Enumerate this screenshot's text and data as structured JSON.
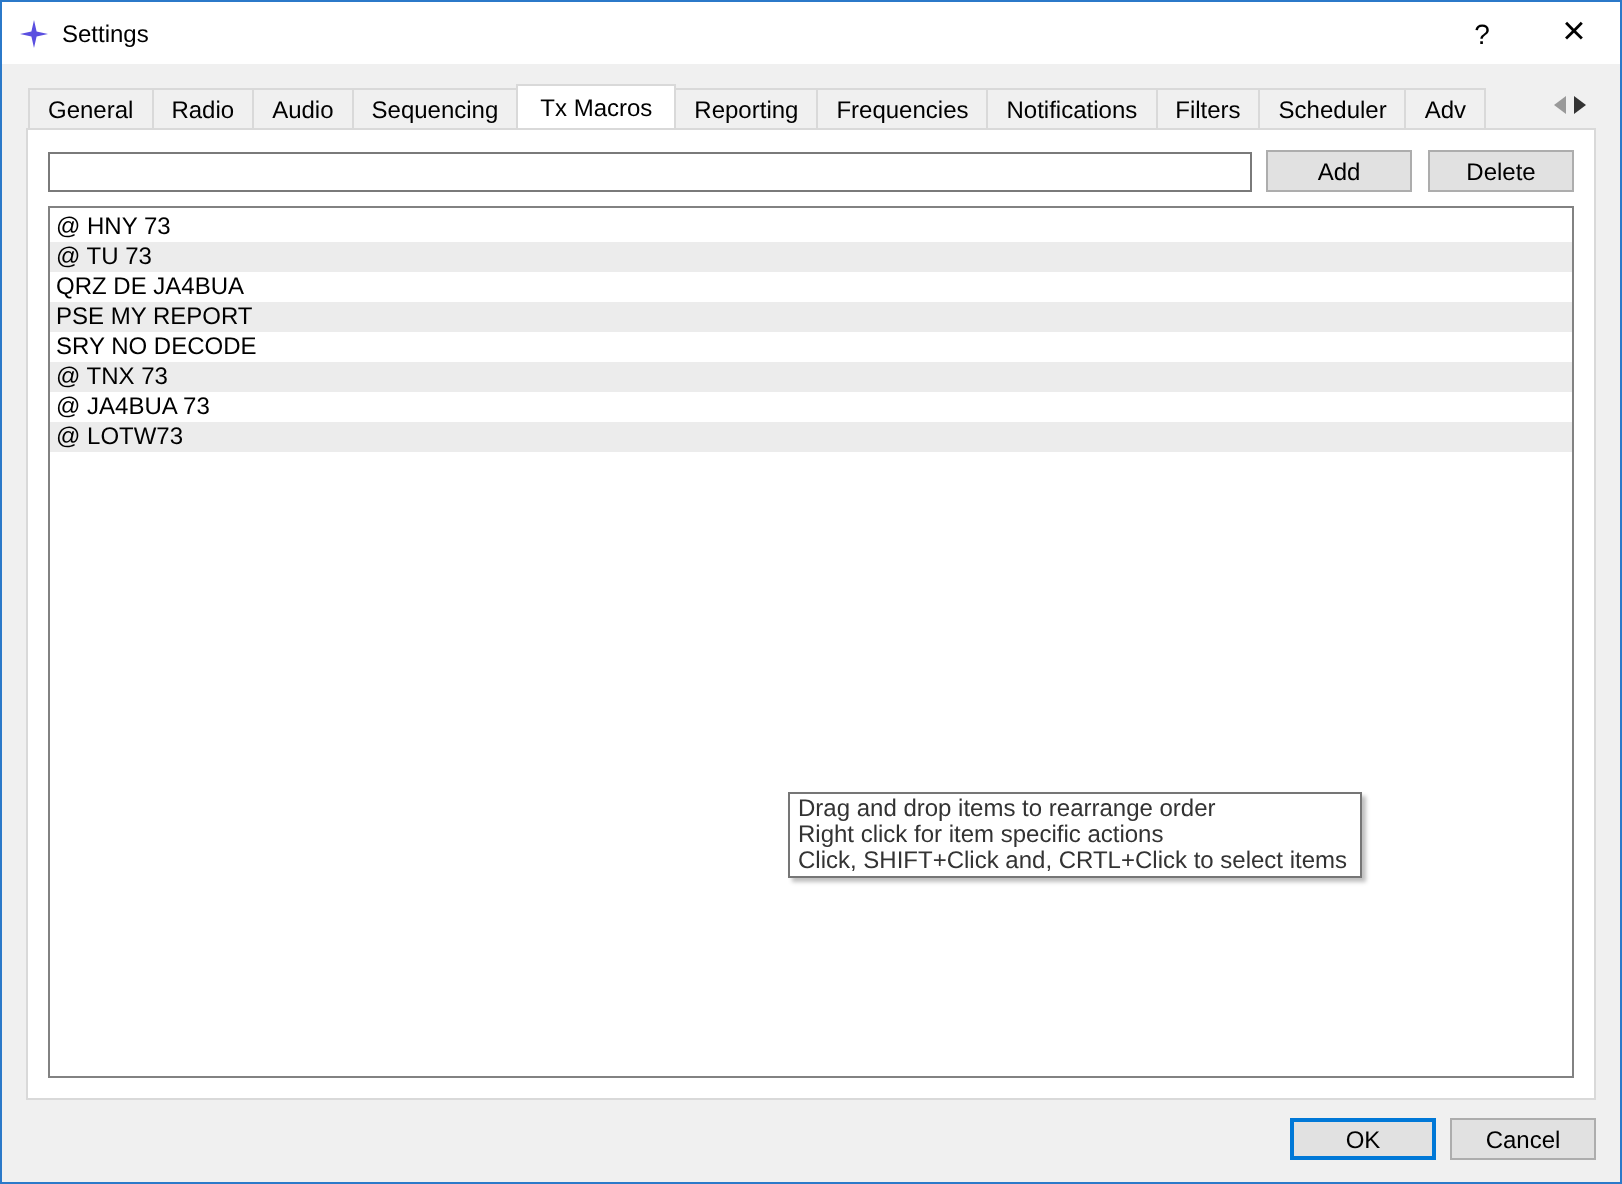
{
  "window": {
    "title": "Settings",
    "help": "?",
    "close": "×"
  },
  "tabs": [
    {
      "label": "General",
      "selected": false
    },
    {
      "label": "Radio",
      "selected": false
    },
    {
      "label": "Audio",
      "selected": false
    },
    {
      "label": "Sequencing",
      "selected": false
    },
    {
      "label": "Tx Macros",
      "selected": true
    },
    {
      "label": "Reporting",
      "selected": false
    },
    {
      "label": "Frequencies",
      "selected": false
    },
    {
      "label": "Notifications",
      "selected": false
    },
    {
      "label": "Filters",
      "selected": false
    },
    {
      "label": "Scheduler",
      "selected": false
    },
    {
      "label": "Adv",
      "selected": false
    }
  ],
  "macro_editor": {
    "add_button": "Add",
    "delete_button": "Delete"
  },
  "macros": [
    "@ HNY 73",
    "@ TU 73",
    "QRZ DE JA4BUA",
    "PSE MY REPORT",
    "SRY NO DECODE",
    "@ TNX 73",
    "@ JA4BUA 73",
    "@ LOTW73"
  ],
  "tooltip": [
    "Drag and drop items to rearrange order",
    "Right click for item specific actions",
    "Click, SHIFT+Click and, CRTL+Click to select items"
  ],
  "buttons": [
    {
      "label": "OK",
      "default": true
    },
    {
      "label": "Cancel",
      "default": false
    }
  ]
}
